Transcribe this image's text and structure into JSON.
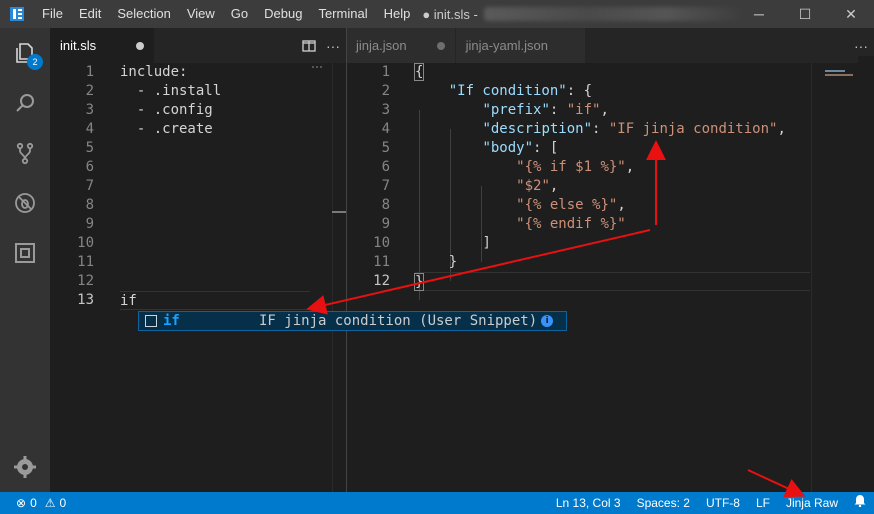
{
  "window": {
    "menu": [
      "File",
      "Edit",
      "Selection",
      "View",
      "Go",
      "Debug",
      "Terminal",
      "Help"
    ],
    "title": "● init.sls -",
    "controls": {
      "minimize": "─",
      "maximize": "☐",
      "close": "✕"
    }
  },
  "activity": {
    "explorer_badge": "2"
  },
  "left_editor": {
    "tab_label": "init.sls",
    "lines": [
      {
        "n": "1",
        "text": "include:"
      },
      {
        "n": "2",
        "text": "  - .install"
      },
      {
        "n": "3",
        "text": "  - .config"
      },
      {
        "n": "4",
        "text": "  - .create"
      },
      {
        "n": "5",
        "text": ""
      },
      {
        "n": "6",
        "text": ""
      },
      {
        "n": "7",
        "text": ""
      },
      {
        "n": "8",
        "text": ""
      },
      {
        "n": "9",
        "text": ""
      },
      {
        "n": "10",
        "text": ""
      },
      {
        "n": "11",
        "text": ""
      },
      {
        "n": "12",
        "text": ""
      },
      {
        "n": "13",
        "text": "if"
      }
    ]
  },
  "right_editor": {
    "tabs": [
      "jinja.json",
      "jinja-yaml.json"
    ],
    "line_numbers": [
      "1",
      "2",
      "3",
      "4",
      "5",
      "6",
      "7",
      "8",
      "9",
      "10",
      "11",
      "12"
    ],
    "code": {
      "l1": "{",
      "l2_key": "\"If condition\"",
      "l2_rest": ": {",
      "l3_key": "\"prefix\"",
      "l3_val": "\"if\"",
      "l4_key": "\"description\"",
      "l4_val": "\"IF jinja condition\"",
      "l5_key": "\"body\"",
      "l5_rest": ": [",
      "l6": "\"{% if $1 %}\"",
      "l7": "\"$2\"",
      "l8": "\"{% else %}\"",
      "l9": "\"{% endif %}\"",
      "l10": "]",
      "l11": "}",
      "l12": "}"
    }
  },
  "suggest": {
    "label": "if",
    "detail": "IF jinja condition (User Snippet)",
    "info": "i"
  },
  "status": {
    "errors": "0",
    "warnings": "0",
    "position": "Ln 13, Col 3",
    "spaces": "Spaces: 2",
    "encoding": "UTF-8",
    "eol": "LF",
    "language": "Jinja Raw"
  },
  "colors": {
    "accent": "#007acc",
    "annotation_arrow": "#e81010"
  }
}
